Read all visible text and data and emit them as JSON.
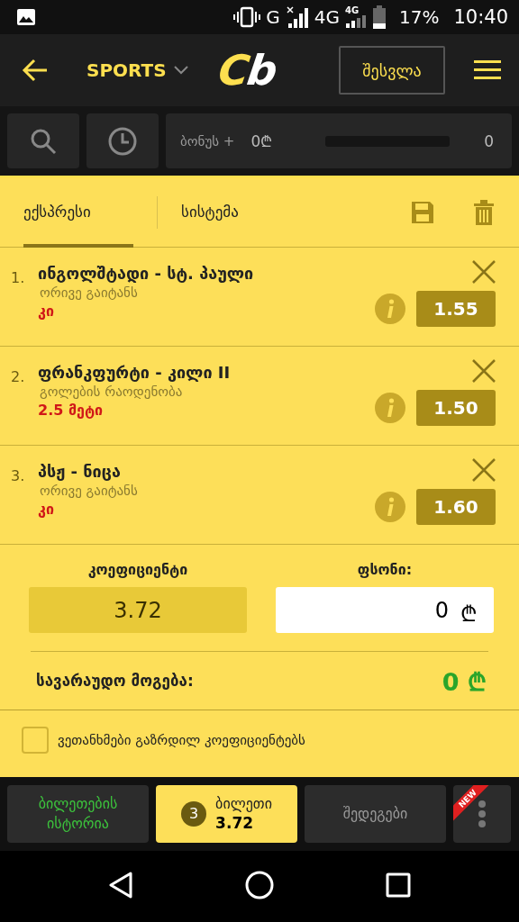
{
  "status_bar": {
    "network_1": "G",
    "network_2": "4G",
    "network_2_badge": "4G",
    "battery": "17%",
    "time": "10:40"
  },
  "header": {
    "section": "SPORTS",
    "logo": "Cb",
    "login": "შესვლა"
  },
  "toolbar": {
    "bonus_label": "ბონუს +",
    "bonus_amount": "0₾",
    "level": 0,
    "bonus_count": "0"
  },
  "tabs": [
    {
      "label": "ექსპრესი",
      "selected": true
    },
    {
      "label": "სისტემა",
      "selected": false
    }
  ],
  "bets": [
    {
      "number": "1.",
      "match": "ინგოლშტადი - სტ. პაული",
      "market": "ორივე გაიტანს",
      "pick": "კი",
      "odds": "1.55"
    },
    {
      "number": "2.",
      "match": "ფრანკფურტი - კილი II",
      "market": "გოლების რაოდენობა",
      "pick": "2.5 მეტი",
      "odds": "1.50"
    },
    {
      "number": "3.",
      "match": "პსჟ - ნიცა",
      "market": "ორივე გაიტანს",
      "pick": "კი",
      "odds": "1.60"
    }
  ],
  "summary": {
    "odds_label": "კოეფიციენტი",
    "odds": "3.72",
    "stake_label": "ფსონი:",
    "stake": "0",
    "currency": "₾",
    "win_label": "სავარაუდო მოგება:",
    "win": "0 ₾"
  },
  "agreements": [
    {
      "label": "ვეთანხმები გაზრდილ კოეფიციენტებს",
      "checked": false
    }
  ],
  "bottom_nav": [
    {
      "kind": "link",
      "label": "ბილეთების ისტორია",
      "selected": false
    },
    {
      "kind": "ticket",
      "count": "3",
      "label": "ბილეთი",
      "odds": "3.72",
      "selected": true
    },
    {
      "kind": "link",
      "label": "შედეგები",
      "selected": false
    },
    {
      "kind": "more",
      "badge": "NEW",
      "selected": false
    }
  ]
}
